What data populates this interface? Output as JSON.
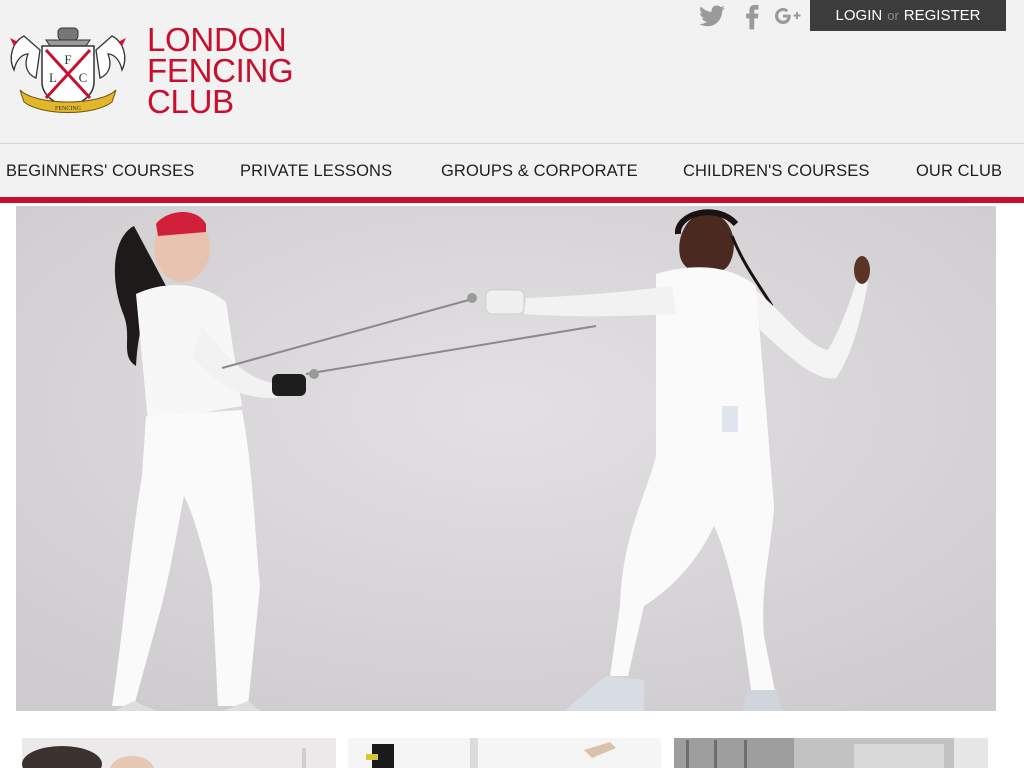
{
  "header": {
    "logo_name": "crest-logo",
    "crest_letters": [
      "F",
      "L",
      "C"
    ],
    "crest_ribbon": "FENCING",
    "brand_lines": [
      "LONDON",
      "FENCING",
      "CLUB"
    ],
    "brand_color": "#c8102e"
  },
  "social": {
    "icons": [
      "twitter-icon",
      "facebook-icon",
      "google-plus-icon"
    ]
  },
  "auth": {
    "login": "LOGIN",
    "or": "or",
    "register": "REGISTER"
  },
  "nav": {
    "items": [
      {
        "label": "BEGINNERS' COURSES"
      },
      {
        "label": "PRIVATE LESSONS"
      },
      {
        "label": "GROUPS & CORPORATE"
      },
      {
        "label": "CHILDREN'S COURSES"
      },
      {
        "label": "OUR CLUB"
      }
    ]
  },
  "hero": {
    "image_name": "hero-fencers-photo"
  },
  "thumbnails": [
    {
      "name": "thumbnail-1"
    },
    {
      "name": "thumbnail-2"
    },
    {
      "name": "thumbnail-3"
    }
  ]
}
